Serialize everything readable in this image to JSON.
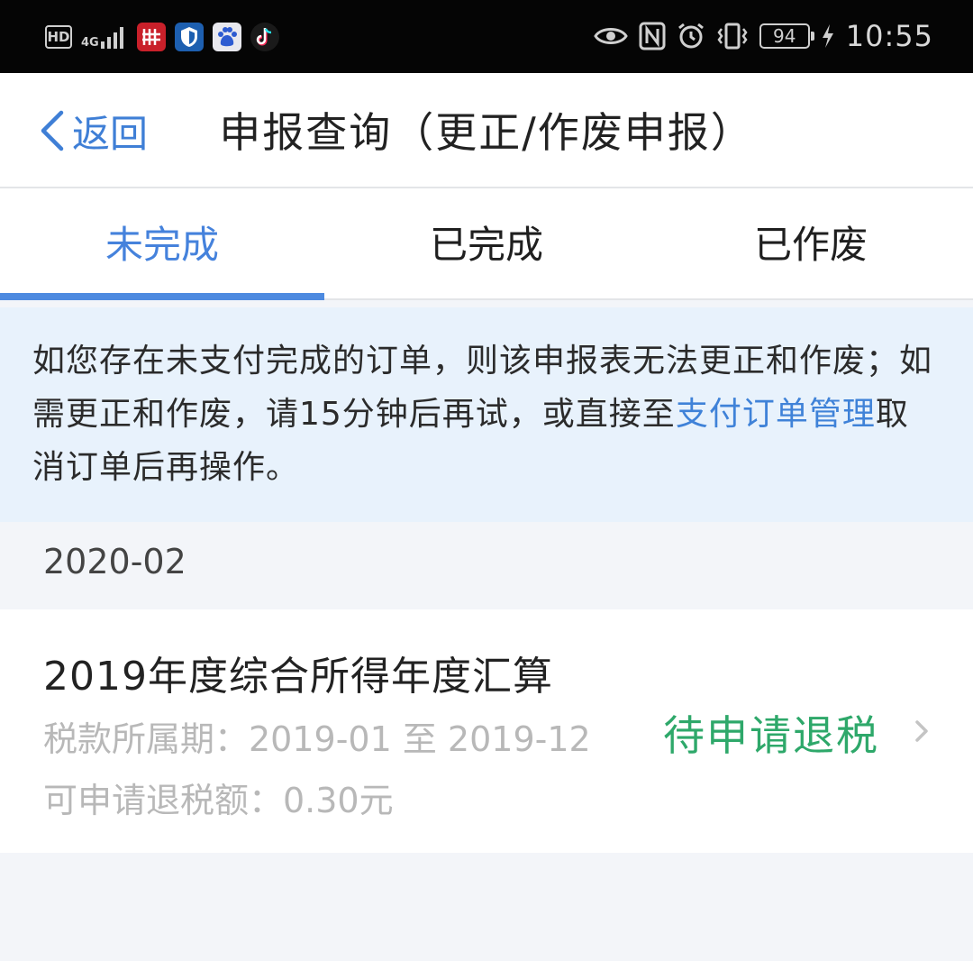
{
  "status_bar": {
    "hd": "HD",
    "network": "4G",
    "battery": "94",
    "time": "10:55",
    "icons": [
      "hd-icon",
      "signal-4g-icon",
      "app-red-icon",
      "shield-app-icon",
      "baidu-app-icon",
      "tiktok-app-icon",
      "eye-icon",
      "nfc-icon",
      "alarm-icon",
      "vibrate-icon",
      "battery-icon",
      "charging-icon"
    ]
  },
  "nav": {
    "back_label": "返回",
    "title": "申报查询（更正/作废申报）"
  },
  "tabs": [
    {
      "label": "未完成",
      "active": true
    },
    {
      "label": "已完成",
      "active": false
    },
    {
      "label": "已作废",
      "active": false
    }
  ],
  "notice": {
    "text_before": "如您存在未支付完成的订单，则该申报表无法更正和作废；如需更正和作废，请15分钟后再试，或直接至",
    "link": "支付订单管理",
    "text_after": "取消订单后再操作。"
  },
  "month": "2020-02",
  "records": [
    {
      "title": "2019年度综合所得年度汇算",
      "period": "税款所属期：2019-01 至 2019-12",
      "amount": "可申请退税额：0.30元",
      "status": "待申请退税"
    }
  ],
  "colors": {
    "accent_blue": "#4582dc",
    "status_green": "#2ea86a",
    "notice_bg": "#e8f2fc"
  }
}
